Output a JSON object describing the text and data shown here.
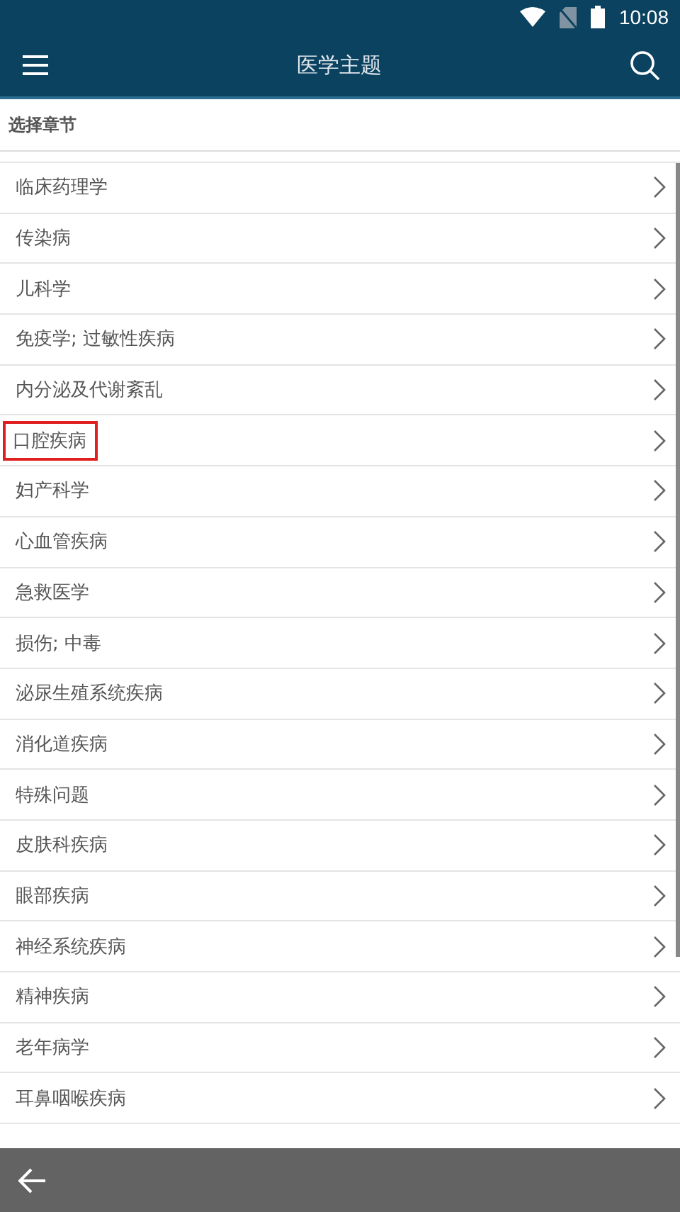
{
  "status_bar": {
    "time": "10:08"
  },
  "app_bar": {
    "title": "医学主题"
  },
  "section_header": "选择章节",
  "chapters": [
    {
      "label": "临床药理学",
      "highlighted": false
    },
    {
      "label": "传染病",
      "highlighted": false
    },
    {
      "label": "儿科学",
      "highlighted": false
    },
    {
      "label": "免疫学; 过敏性疾病",
      "highlighted": false
    },
    {
      "label": "内分泌及代谢紊乱",
      "highlighted": false
    },
    {
      "label": "口腔疾病",
      "highlighted": true
    },
    {
      "label": "妇产科学",
      "highlighted": false
    },
    {
      "label": "心血管疾病",
      "highlighted": false
    },
    {
      "label": "急救医学",
      "highlighted": false
    },
    {
      "label": "损伤; 中毒",
      "highlighted": false
    },
    {
      "label": "泌尿生殖系统疾病",
      "highlighted": false
    },
    {
      "label": "消化道疾病",
      "highlighted": false
    },
    {
      "label": "特殊问题",
      "highlighted": false
    },
    {
      "label": "皮肤科疾病",
      "highlighted": false
    },
    {
      "label": "眼部疾病",
      "highlighted": false
    },
    {
      "label": "神经系统疾病",
      "highlighted": false
    },
    {
      "label": "精神疾病",
      "highlighted": false
    },
    {
      "label": "老年病学",
      "highlighted": false
    },
    {
      "label": "耳鼻咽喉疾病",
      "highlighted": false
    }
  ]
}
